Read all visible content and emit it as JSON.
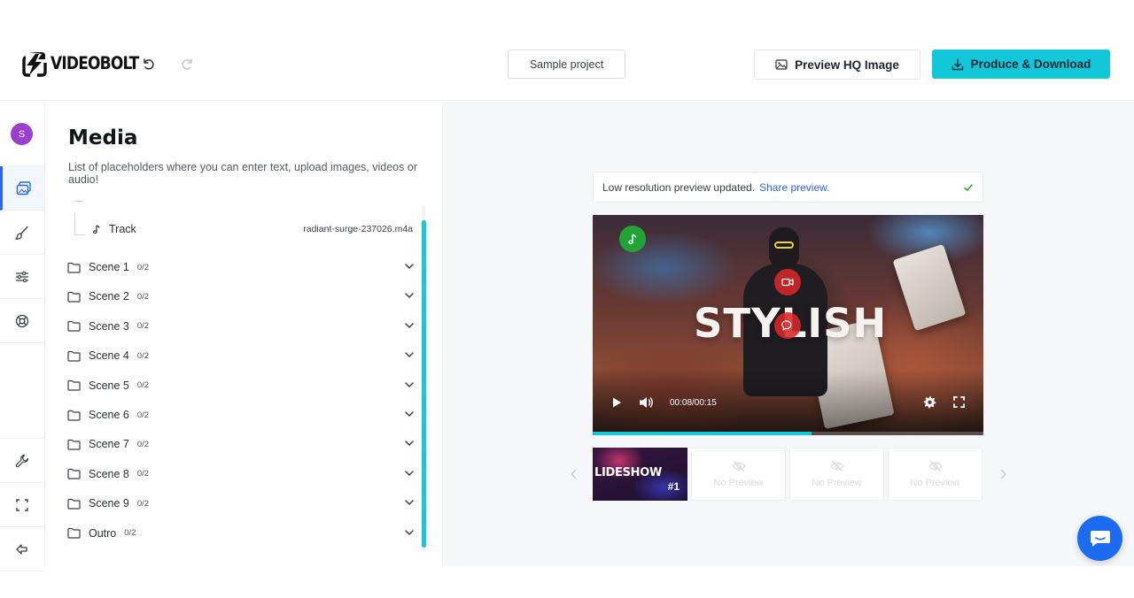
{
  "header": {
    "logo_text": "VIDEOBOLT",
    "project_name": "Sample project",
    "preview_hq_label": "Preview HQ Image",
    "produce_label": "Produce & Download"
  },
  "user": {
    "initial": "S"
  },
  "media": {
    "title": "Media",
    "subtitle": "List of placeholders where you can enter text, upload images, videos or audio!",
    "track": {
      "label": "Track",
      "file": "radiant-surge-237026.m4a"
    },
    "scenes": [
      {
        "name": "Scene 1",
        "count": "0/2"
      },
      {
        "name": "Scene 2",
        "count": "0/2"
      },
      {
        "name": "Scene 3",
        "count": "0/2"
      },
      {
        "name": "Scene 4",
        "count": "0/2"
      },
      {
        "name": "Scene 5",
        "count": "0/2"
      },
      {
        "name": "Scene 6",
        "count": "0/2"
      },
      {
        "name": "Scene 7",
        "count": "0/2"
      },
      {
        "name": "Scene 8",
        "count": "0/2"
      },
      {
        "name": "Scene 9",
        "count": "0/2"
      },
      {
        "name": "Outro",
        "count": "0/2"
      }
    ]
  },
  "preview": {
    "notice": "Low resolution preview updated.",
    "share_label": "Share preview.",
    "video_text": "STYLISH",
    "time": "00:08/00:15",
    "progress": 0.56,
    "thumbs": [
      {
        "title": "LIDESHOW",
        "number": "#1"
      },
      {
        "label": "No Preview"
      },
      {
        "label": "No Preview"
      },
      {
        "label": "No Preview"
      }
    ]
  },
  "colors": {
    "accent": "#11c7d8",
    "active_blue": "#2a66f6",
    "avatar": "#9b3fd0",
    "chat": "#1c6cf2"
  }
}
